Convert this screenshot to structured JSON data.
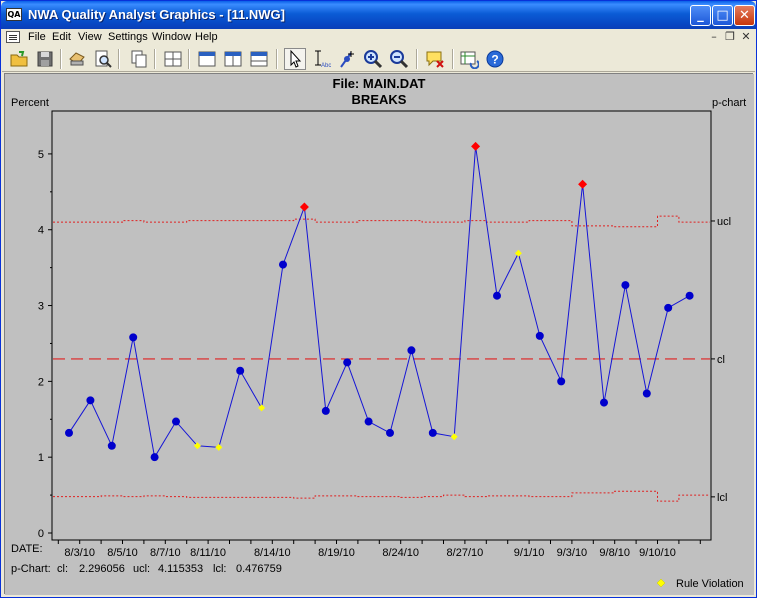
{
  "window": {
    "title": "NWA Quality Analyst Graphics - [11.NWG]",
    "app_icon_text": "QA",
    "controls": {
      "minimize": "_",
      "maximize": "□",
      "close": "✕"
    }
  },
  "menu": {
    "items": [
      "File",
      "Edit",
      "View",
      "Settings",
      "Window",
      "Help"
    ],
    "mdi_controls": {
      "minimize": "–",
      "restore": "❐",
      "close": "✕"
    }
  },
  "toolbar": {
    "tools": [
      "open-folder",
      "save-disk",
      "print",
      "print-preview",
      "copy",
      "grid-layout",
      "single-chart",
      "split-vertical",
      "split-horizontal",
      "pointer",
      "text-annotation",
      "point-marker",
      "zoom-in",
      "zoom-out",
      "clear-annotation",
      "refresh-data",
      "help"
    ],
    "active_tool": "pointer"
  },
  "colors": {
    "plot_bg": "#c0c0c0",
    "line": "#1515d6",
    "point": "#0000cc",
    "violation": "#ff0000",
    "rule_violation": "#ffff00",
    "control_limit": "#e02020"
  },
  "chart_data": {
    "type": "line",
    "title": "File: MAIN.DAT",
    "subtitle": "BREAKS",
    "ylabel": "Percent",
    "chart_kind_label": "p-chart",
    "x_axis_label": "DATE:",
    "ylim": [
      0,
      5.5
    ],
    "y_ticks": [
      0,
      1,
      2,
      3,
      4,
      5
    ],
    "x_tick_labels": [
      {
        "index": 0.5,
        "label": "8/3/10"
      },
      {
        "index": 2.5,
        "label": "8/5/10"
      },
      {
        "index": 4.5,
        "label": "8/7/10"
      },
      {
        "index": 6.5,
        "label": "8/11/10"
      },
      {
        "index": 9.5,
        "label": "8/14/10"
      },
      {
        "index": 12.5,
        "label": "8/19/10"
      },
      {
        "index": 15.5,
        "label": "8/24/10"
      },
      {
        "index": 18.5,
        "label": "8/27/10"
      },
      {
        "index": 21.5,
        "label": "9/1/10"
      },
      {
        "index": 23.5,
        "label": "9/3/10"
      },
      {
        "index": 25.5,
        "label": "9/8/10"
      },
      {
        "index": 27.5,
        "label": "9/10/10"
      }
    ],
    "series": [
      {
        "values": [
          1.32,
          1.75,
          1.15,
          2.58,
          1.0,
          1.47,
          1.15,
          1.13,
          2.14,
          1.65,
          3.54,
          4.3,
          1.61,
          2.25,
          1.47,
          1.32,
          2.41,
          1.32,
          1.27,
          5.1,
          3.13,
          3.69,
          2.6,
          2.0,
          4.6,
          1.72,
          3.27,
          1.84,
          2.97,
          3.13
        ],
        "status": [
          "n",
          "n",
          "n",
          "n",
          "n",
          "n",
          "r",
          "r",
          "n",
          "r",
          "n",
          "v",
          "n",
          "n",
          "n",
          "n",
          "n",
          "n",
          "r",
          "v",
          "n",
          "r",
          "n",
          "n",
          "v",
          "n",
          "n",
          "n",
          "n",
          "n"
        ]
      }
    ],
    "control_limits": {
      "cl": 2.296056,
      "ucl": 4.115353,
      "lcl": 0.476759,
      "labels": {
        "ucl": "ucl",
        "cl": "cl",
        "lcl": "lcl"
      },
      "ucl_by_segment": [
        4.1,
        4.1,
        4.1,
        4.12,
        4.1,
        4.1,
        4.12,
        4.12,
        4.12,
        4.12,
        4.12,
        4.14,
        4.1,
        4.1,
        4.12,
        4.12,
        4.12,
        4.1,
        4.1,
        4.12,
        4.1,
        4.1,
        4.12,
        4.12,
        4.05,
        4.05,
        4.04,
        4.04,
        4.18,
        4.1
      ],
      "lcl_by_segment": [
        0.48,
        0.48,
        0.49,
        0.48,
        0.49,
        0.48,
        0.47,
        0.47,
        0.47,
        0.47,
        0.47,
        0.46,
        0.49,
        0.49,
        0.48,
        0.48,
        0.47,
        0.48,
        0.5,
        0.48,
        0.49,
        0.49,
        0.48,
        0.48,
        0.53,
        0.53,
        0.55,
        0.55,
        0.42,
        0.5
      ]
    },
    "stats_line": {
      "prefix": "p-Chart:",
      "cl_label": "cl:",
      "cl_value": "2.296056",
      "ucl_label": "ucl:",
      "ucl_value": "4.115353",
      "lcl_label": "lcl:",
      "lcl_value": "0.476759"
    },
    "legend": {
      "label": "Rule Violation",
      "placement": "bottom-right"
    },
    "grid": false
  }
}
